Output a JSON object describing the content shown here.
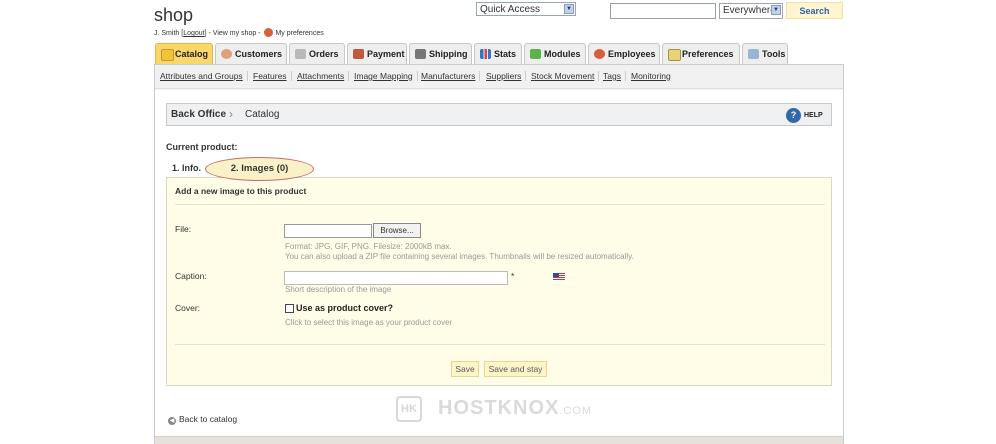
{
  "header": {
    "shop_name": "shop",
    "user_name": "J. Smith",
    "logout_label": "Logout",
    "view_shop_label": "View my shop",
    "preferences_label": "My preferences",
    "quick_access_label": "Quick Access",
    "search_placeholder": "",
    "search_scope": "Everywhere",
    "search_button": "Search"
  },
  "tabs": [
    {
      "label": "Catalog",
      "active": true
    },
    {
      "label": "Customers"
    },
    {
      "label": "Orders"
    },
    {
      "label": "Payment"
    },
    {
      "label": "Shipping"
    },
    {
      "label": "Stats"
    },
    {
      "label": "Modules"
    },
    {
      "label": "Employees"
    },
    {
      "label": "Preferences"
    },
    {
      "label": "Tools"
    }
  ],
  "subnav": [
    "Attributes and Groups",
    "Features",
    "Attachments",
    "Image Mapping",
    "Manufacturers",
    "Suppliers",
    "Stock Movement",
    "Tags",
    "Monitoring"
  ],
  "breadcrumb": {
    "root": "Back Office",
    "current": "Catalog",
    "help_label": "HELP"
  },
  "product": {
    "current_label": "Current product:",
    "tab_info": "1. Info.",
    "tab_images": "2. Images (0)"
  },
  "form": {
    "panel_title": "Add a new image to this product",
    "file_label": "File:",
    "browse_label": "Browse...",
    "file_hint_1": "Format: JPG, GIF, PNG. Filesize: 2000kB max.",
    "file_hint_2": "You can also upload a ZIP file containing several images. Thumbnails will be resized automatically.",
    "caption_label": "Caption:",
    "caption_required": "*",
    "caption_hint": "Short description of the image",
    "cover_label": "Cover:",
    "cover_checkbox_label": "Use as product cover?",
    "cover_hint": "Click to select this image as your product cover",
    "save_label": "Save",
    "save_stay_label": "Save and stay"
  },
  "back_link": "Back to catalog",
  "watermark": {
    "logo": "HK",
    "text": "HOSTKNOX",
    "suffix": ".COM"
  },
  "colors": {
    "active_tab": "#fbd66c",
    "panel_bg": "#fffde8",
    "button_bg": "#fff4c8",
    "link_blue": "#2c61a8"
  }
}
